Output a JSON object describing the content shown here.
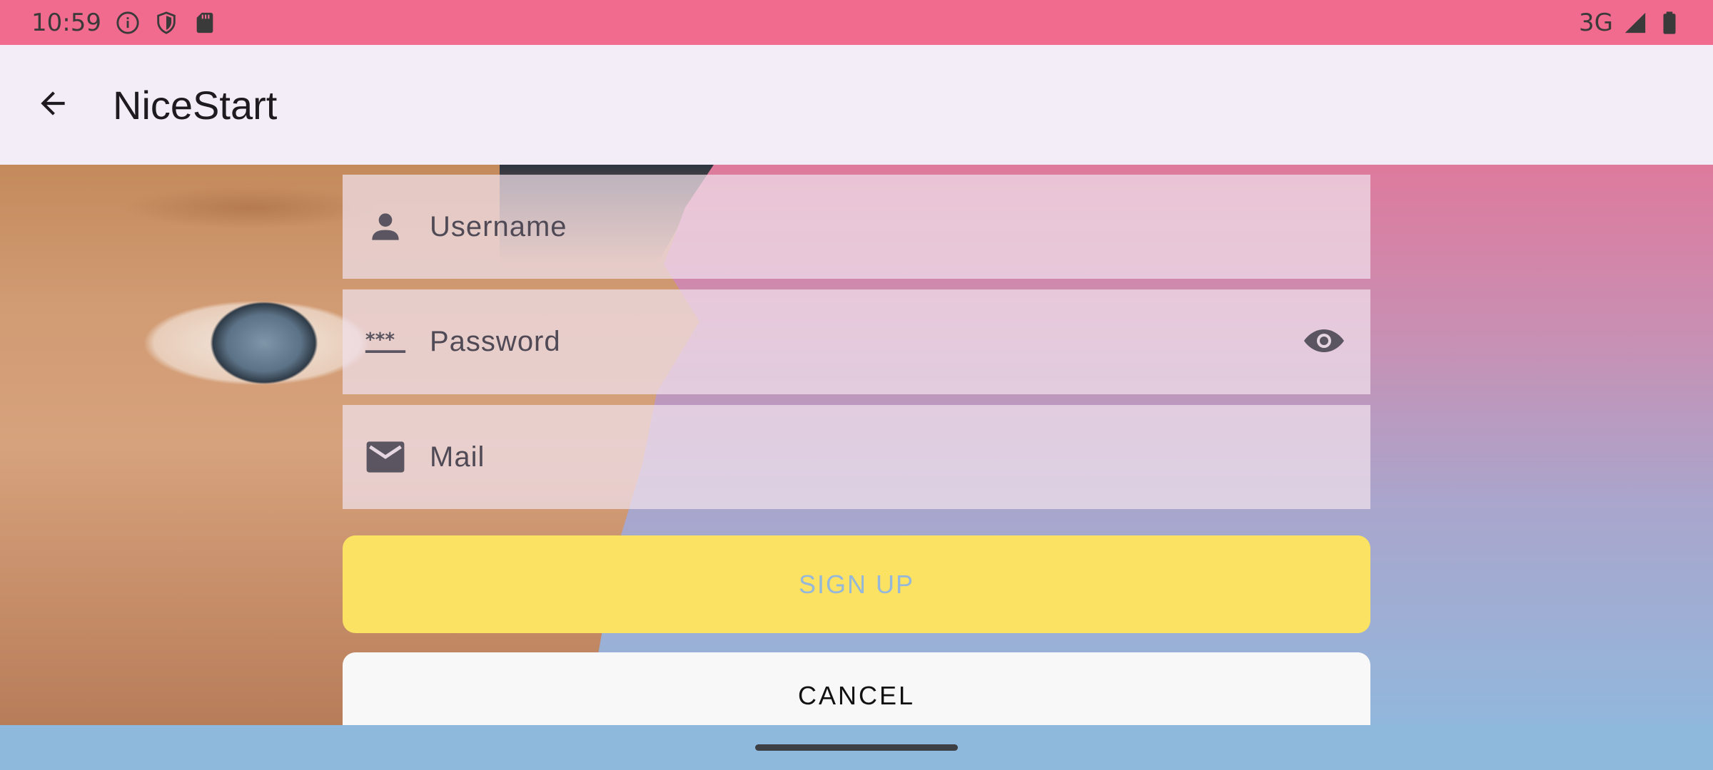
{
  "status_bar": {
    "time": "10:59",
    "network": "3G",
    "icons": [
      "info-icon",
      "shield-icon",
      "sd-card-icon",
      "signal-icon",
      "battery-icon"
    ]
  },
  "app_bar": {
    "title": "NiceStart",
    "back_icon": "arrow-back-icon"
  },
  "form": {
    "username": {
      "placeholder": "Username",
      "value": "",
      "icon": "person-icon"
    },
    "password": {
      "placeholder": "Password",
      "value": "",
      "icon": "password-icon",
      "toggle_icon": "eye-icon"
    },
    "mail": {
      "placeholder": "Mail",
      "value": "",
      "icon": "mail-icon"
    }
  },
  "buttons": {
    "signup_label": "SIGN UP",
    "cancel_label": "CANCEL"
  },
  "colors": {
    "status_bar": "#f06b8e",
    "app_bar": "#f3edf7",
    "signup_bg": "#fce262",
    "signup_text": "#95b7d9",
    "cancel_bg": "#f8f8f8",
    "nav_bar": "#8fb8dd"
  }
}
